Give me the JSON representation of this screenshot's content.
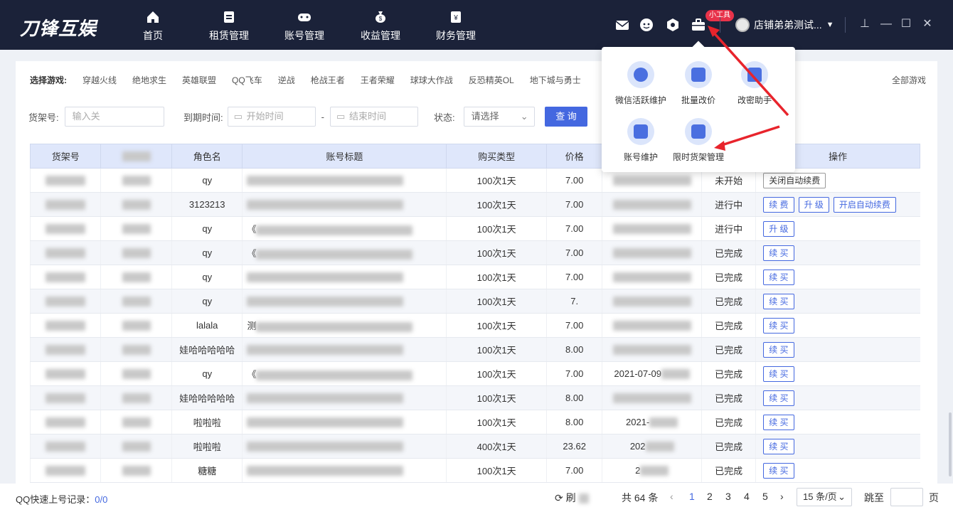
{
  "app": {
    "logo": "刀锋互娱"
  },
  "nav": [
    {
      "label": "首页",
      "icon": "home-icon"
    },
    {
      "label": "租赁管理",
      "icon": "document-icon"
    },
    {
      "label": "账号管理",
      "icon": "gamepad-icon"
    },
    {
      "label": "收益管理",
      "icon": "money-bag-icon"
    },
    {
      "label": "财务管理",
      "icon": "yen-icon"
    }
  ],
  "header": {
    "tools_badge": "小工具",
    "user_name": "店铺弟弟测试..."
  },
  "games": {
    "label": "选择游戏:",
    "items": [
      "穿越火线",
      "绝地求生",
      "英雄联盟",
      "QQ飞车",
      "逆战",
      "枪战王者",
      "王者荣耀",
      "球球大作战",
      "反恐精英OL",
      "地下城与勇士"
    ],
    "all": "全部游戏"
  },
  "filters": {
    "shelf_label": "货架号:",
    "shelf_placeholder": "输入关",
    "expire_label": "到期时间:",
    "start_placeholder": "开始时间",
    "dash": "-",
    "end_placeholder": "结束时间",
    "status_label": "状态:",
    "status_placeholder": "请选择",
    "query_button": "查 询"
  },
  "table": {
    "headers": [
      "货架号",
      "",
      "角色名",
      "账号标题",
      "购买类型",
      "价格",
      "",
      "",
      "操作"
    ],
    "rows": [
      {
        "role": "qy",
        "title": "",
        "type": "100次1天",
        "price": "7.00",
        "time": "",
        "status": "未开始",
        "status_class": "",
        "ops": [
          "关闭自动续费"
        ]
      },
      {
        "role": "3123213",
        "title": "",
        "type": "100次1天",
        "price": "7.00",
        "time": "",
        "status": "进行中",
        "status_class": "green",
        "ops": [
          "续 费",
          "升 级",
          "开启自动续费"
        ]
      },
      {
        "role": "qy",
        "title": "《",
        "type": "100次1天",
        "price": "7.00",
        "time": "",
        "status": "进行中",
        "status_class": "green",
        "ops": [
          "升 级"
        ]
      },
      {
        "role": "qy",
        "title": "《",
        "type": "100次1天",
        "price": "7.00",
        "time": "",
        "status": "已完成",
        "status_class": "",
        "ops": [
          "续 买"
        ]
      },
      {
        "role": "qy",
        "title": "",
        "type": "100次1天",
        "price": "7.00",
        "time": "",
        "status": "已完成",
        "status_class": "",
        "ops": [
          "续 买"
        ]
      },
      {
        "role": "qy",
        "title": "",
        "type": "100次1天",
        "price": "7.",
        "time": "",
        "status": "已完成",
        "status_class": "",
        "ops": [
          "续 买"
        ]
      },
      {
        "role": "lalala",
        "title": "测",
        "type": "100次1天",
        "price": "7.00",
        "time": "",
        "status": "已完成",
        "status_class": "",
        "ops": [
          "续 买"
        ]
      },
      {
        "role": "娃哈哈哈哈哈",
        "title": "",
        "type": "100次1天",
        "price": "8.00",
        "time": "",
        "status": "已完成",
        "status_class": "",
        "ops": [
          "续 买"
        ]
      },
      {
        "role": "qy",
        "title": "《",
        "type": "100次1天",
        "price": "7.00",
        "time": "2021-07-09",
        "status": "已完成",
        "status_class": "",
        "ops": [
          "续 买"
        ]
      },
      {
        "role": "娃哈哈哈哈哈",
        "title": "",
        "type": "100次1天",
        "price": "8.00",
        "time": "",
        "status": "已完成",
        "status_class": "",
        "ops": [
          "续 买"
        ]
      },
      {
        "role": "啦啦啦",
        "title": "",
        "type": "100次1天",
        "price": "8.00",
        "time": "2021-",
        "status": "已完成",
        "status_class": "",
        "ops": [
          "续 买"
        ]
      },
      {
        "role": "啦啦啦",
        "title": "",
        "type": "400次1天",
        "price": "23.62",
        "time": "202",
        "status": "已完成",
        "status_class": "",
        "ops": [
          "续 买"
        ]
      },
      {
        "role": "糖糖",
        "title": "",
        "type": "100次1天",
        "price": "7.00",
        "time": "2",
        "status": "已完成",
        "status_class": "",
        "ops": [
          "续 买"
        ]
      }
    ]
  },
  "popup": {
    "tools": [
      {
        "label": "微信活跃维护",
        "icon": "wechat-icon"
      },
      {
        "label": "批量改价",
        "icon": "batch-price-icon"
      },
      {
        "label": "改密助手",
        "icon": "lock-icon"
      },
      {
        "label": "账号维护",
        "icon": "account-settings-icon"
      },
      {
        "label": "限时货架管理",
        "icon": "timer-shelf-icon"
      }
    ]
  },
  "footer": {
    "qq_label": "QQ快速上号记录：",
    "qq_count": "0/0",
    "refresh": "刷",
    "total": "共 64 条",
    "pages": [
      "1",
      "2",
      "3",
      "4",
      "5"
    ],
    "prev": "‹",
    "next": "›",
    "page_size": "15 条/页",
    "goto_label": "跳至",
    "goto_unit": "页"
  },
  "colors": {
    "accent": "#4468e0",
    "nav_bg": "#1b2239",
    "orange": "#f07c2a",
    "green": "#2cad4f",
    "badge": "#e8334a"
  }
}
